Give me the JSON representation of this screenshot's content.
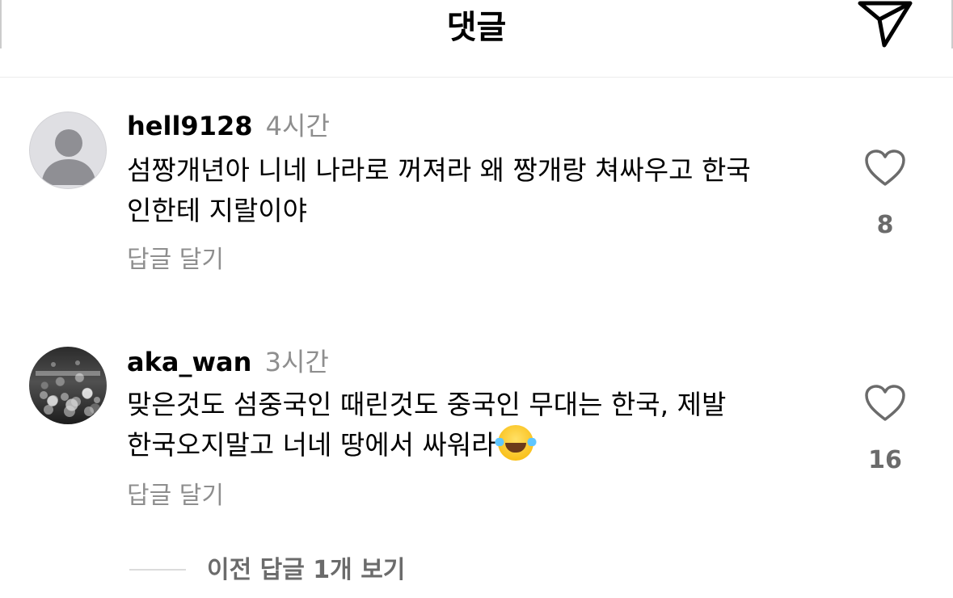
{
  "header": {
    "title": "댓글",
    "send_icon": "paper-plane-icon"
  },
  "comments": [
    {
      "username": "hell9128",
      "time": "4시간",
      "text": "섬짱개년아 니네 나라로 꺼져라 왜 짱개랑 쳐싸우고 한국\n인한테 지랄이야",
      "reply_label": "답글 달기",
      "like_count": "8",
      "avatar": "default-avatar-icon"
    },
    {
      "username": "aka_wan",
      "time": "3시간",
      "text": "맞은것도 섬중국인 때린것도 중국인 무대는 한국, 제발\n한국오지말고 너네 땅에서 싸워라",
      "emoji": "face-with-tears-of-joy-icon",
      "reply_label": "답글 달기",
      "like_count": "16",
      "avatar": "concert-crowd-photo",
      "view_previous_replies": "이전 답글 1개 보기"
    }
  ]
}
